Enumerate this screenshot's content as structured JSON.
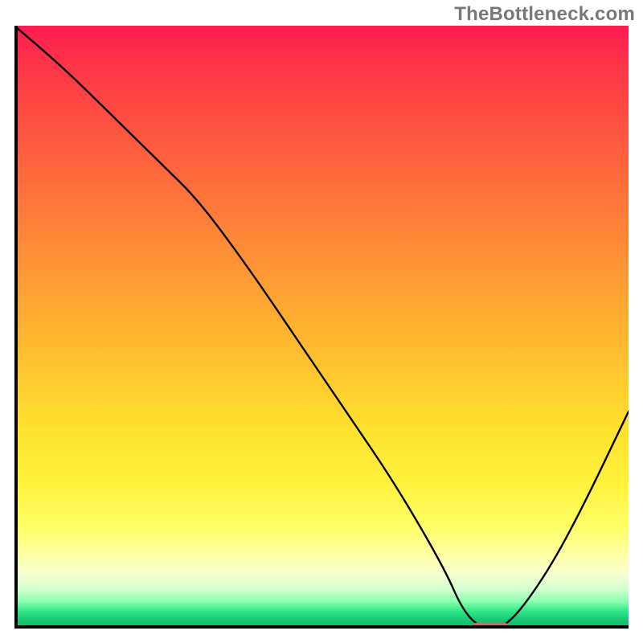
{
  "watermark": "TheBottleneck.com",
  "colors": {
    "axis": "#000000",
    "curve": "#000000",
    "marker": "#d4656d",
    "watermark": "#78787a",
    "gradient_stops": [
      "#ff1b50",
      "#ff3348",
      "#ff5640",
      "#ff783a",
      "#ffa133",
      "#ffc22e",
      "#ffe12e",
      "#fff23c",
      "#ffff66",
      "#ffffa8",
      "#f6ffd0",
      "#d2ffd0",
      "#8bffb0",
      "#35e98a",
      "#18c874",
      "#0fb867"
    ]
  },
  "chart_data": {
    "type": "line",
    "title": "",
    "xlabel": "",
    "ylabel": "",
    "xlim": [
      0,
      100
    ],
    "ylim": [
      0,
      100
    ],
    "x": [
      0,
      8,
      16,
      24,
      30,
      38,
      46,
      54,
      62,
      70,
      73,
      76,
      80,
      86,
      92,
      100
    ],
    "y": [
      100,
      93,
      85,
      77,
      71,
      60,
      48,
      36,
      24,
      10,
      3,
      0,
      0,
      8,
      19,
      36
    ],
    "marker": {
      "x": 77.5,
      "y": 0,
      "width": 6,
      "height": 1.4
    },
    "note": "x/y are fractional positions (0-100) across the plotting frame; y=0 is the bottom axis, y=100 is the top edge."
  }
}
